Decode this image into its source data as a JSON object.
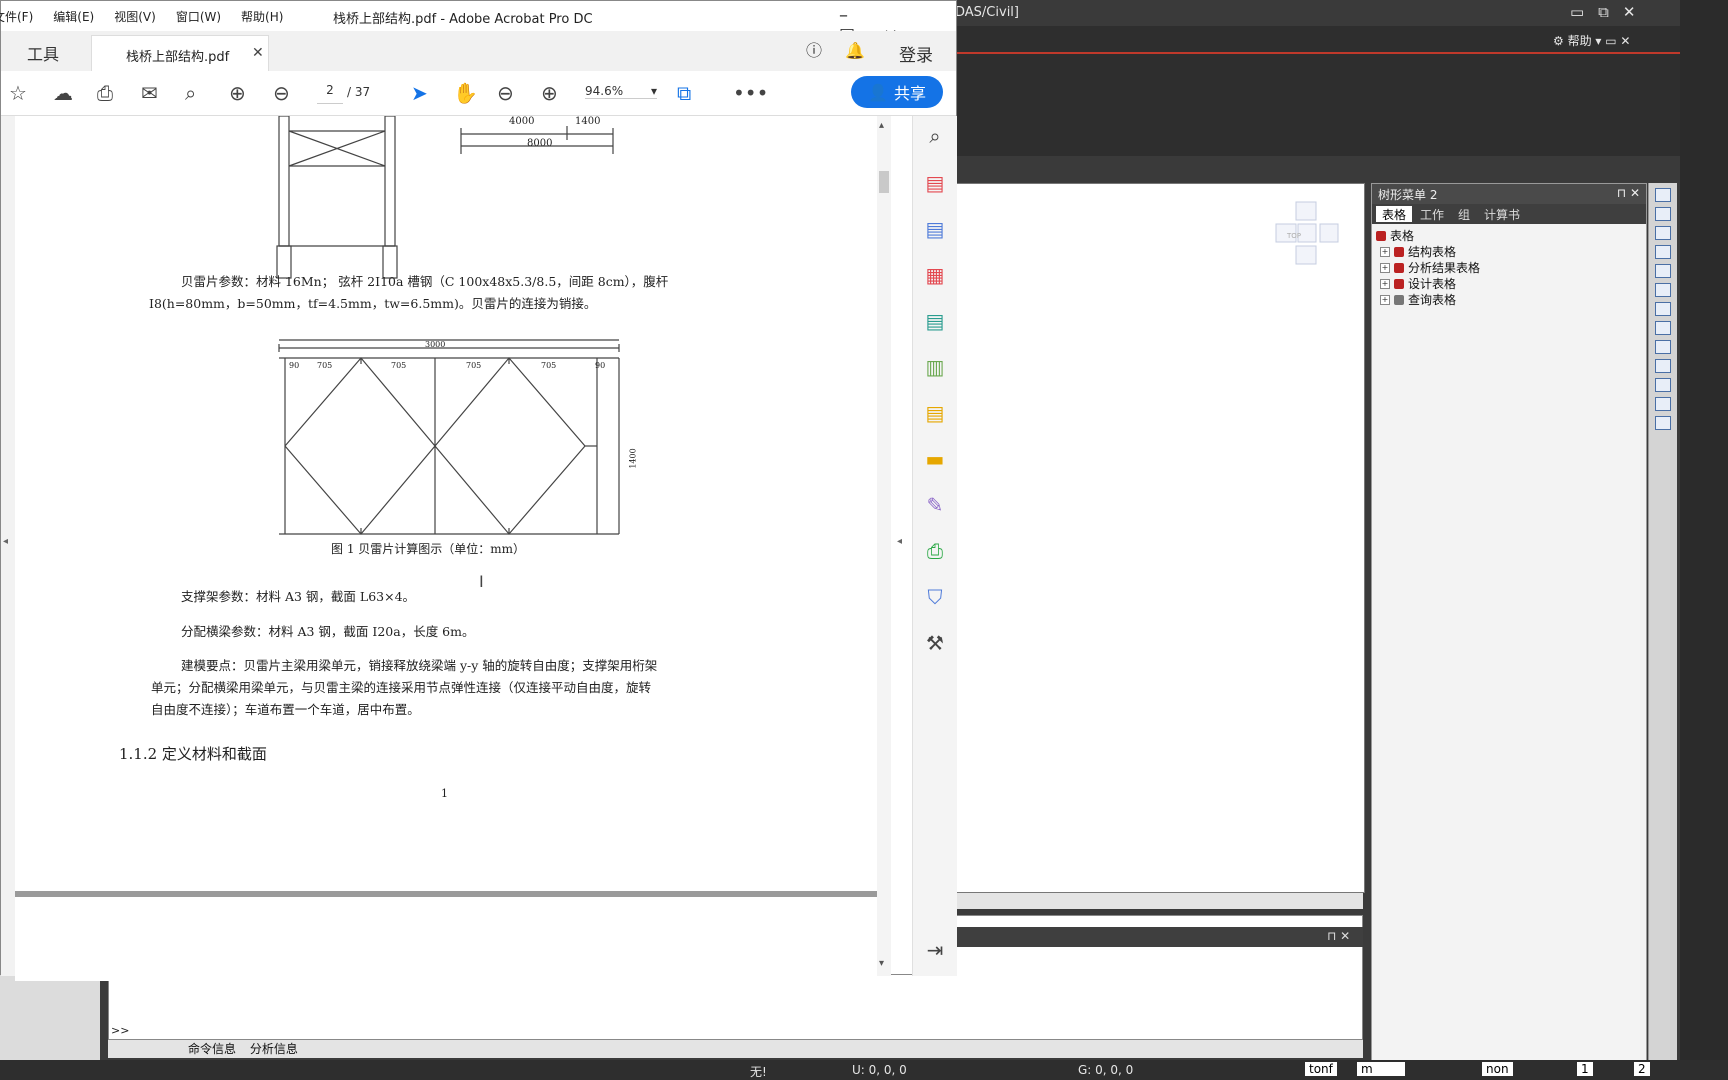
{
  "midas": {
    "title": "DAS/Civil]",
    "help": "帮助",
    "tree_menu": {
      "title": "树形菜单 2",
      "tabs": [
        "表格",
        "工作",
        "组",
        "计算书"
      ],
      "root": "表格",
      "items": [
        "结构表格",
        "分析结果表格",
        "设计表格",
        "查询表格"
      ]
    },
    "command": {
      "prompt": ">>",
      "tabs": [
        "命令信息",
        "分析信息"
      ]
    },
    "status": {
      "none": "无!",
      "u": "U: 0, 0, 0",
      "g": "G: 0, 0, 0",
      "unit_force": "tonf",
      "unit_length": "m",
      "mode": "non",
      "page": "1",
      "page_total": "2"
    },
    "view_cube_label": "TOP"
  },
  "acrobat": {
    "menu": [
      "文件(F)",
      "编辑(E)",
      "视图(V)",
      "窗口(W)",
      "帮助(H)"
    ],
    "title": "栈桥上部结构.pdf - Adobe Acrobat Pro DC",
    "tab_tools": "工具",
    "tab_doc": "栈桥上部结构.pdf",
    "login": "登录",
    "page_current": "2",
    "page_total": "/ 37",
    "zoom": "94.6%",
    "share": "共享"
  },
  "document": {
    "top_dims": [
      "4000",
      "1400",
      "8000"
    ],
    "para_beilei_1": "贝雷片参数：材料 16Mn；  弦杆 2I10a  槽钢（C 100x48x5.3/8.5，间距  8cm），腹杆",
    "para_beilei_2": "I8(h=80mm，b=50mm，tf=4.5mm，tw=6.5mm)。贝雷片的连接为销接。",
    "fig_dims": [
      "3000",
      "90",
      "705",
      "705",
      "705",
      "705",
      "90",
      "1400"
    ],
    "fig_caption": "图 1  贝雷片计算图示（单位：mm）",
    "para_support": "支撑架参数：材料  A3  钢，截面  L63×4。",
    "para_beam": "分配横梁参数：材料  A3  钢，截面  I20a，长度  6m。",
    "para_model_1": "建模要点：贝雷片主梁用梁单元，销接释放绕梁端  y-y  轴的旋转自由度；支撑架用桁架",
    "para_model_2": "单元；分配横梁用梁单元，与贝雷主梁的连接采用节点弹性连接（仅连接平动自由度，旋转",
    "para_model_3": "自由度不连接）；车道布置一个车道，居中布置。",
    "heading": "1.1.2 定义材料和截面",
    "page_number": "1"
  },
  "colors": {
    "acrobat_blue": "#1473e6",
    "midas_dark": "#3a3a3a",
    "midas_red": "#c0392b"
  }
}
